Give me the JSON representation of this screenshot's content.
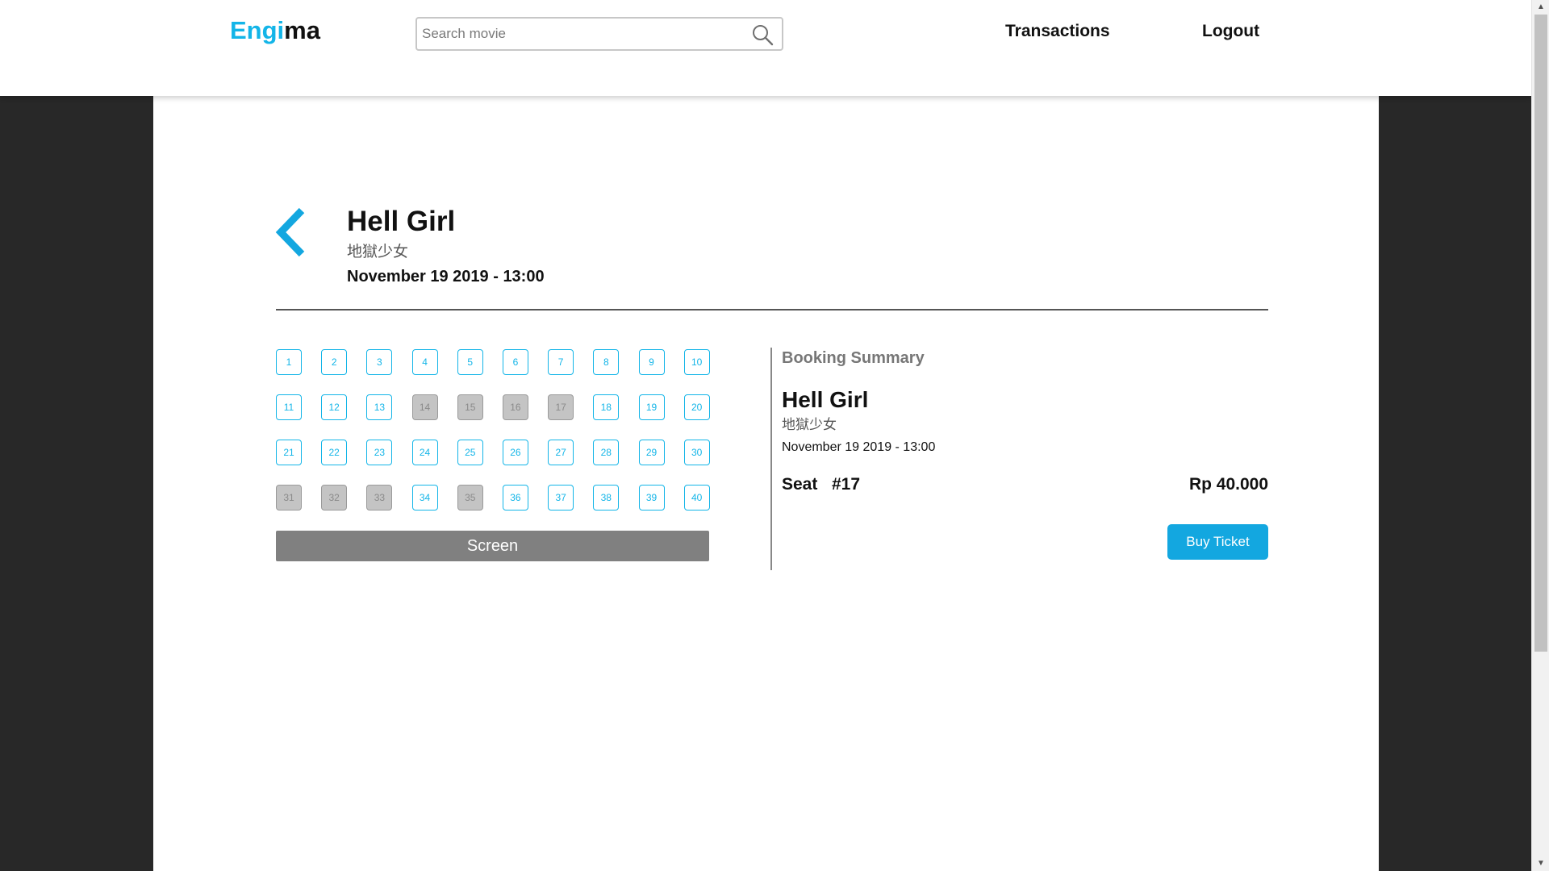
{
  "brand": {
    "part1": "Engi",
    "part2": "ma"
  },
  "search": {
    "placeholder": "Search movie",
    "value": ""
  },
  "nav": {
    "transactions": "Transactions",
    "logout": "Logout"
  },
  "movie": {
    "title": "Hell Girl",
    "subtitle": "地獄少女",
    "datetime": "November 19 2019 - 13:00"
  },
  "seats": [
    {
      "n": "1",
      "taken": false
    },
    {
      "n": "2",
      "taken": false
    },
    {
      "n": "3",
      "taken": false
    },
    {
      "n": "4",
      "taken": false
    },
    {
      "n": "5",
      "taken": false
    },
    {
      "n": "6",
      "taken": false
    },
    {
      "n": "7",
      "taken": false
    },
    {
      "n": "8",
      "taken": false
    },
    {
      "n": "9",
      "taken": false
    },
    {
      "n": "10",
      "taken": false
    },
    {
      "n": "11",
      "taken": false
    },
    {
      "n": "12",
      "taken": false
    },
    {
      "n": "13",
      "taken": false
    },
    {
      "n": "14",
      "taken": true
    },
    {
      "n": "15",
      "taken": true
    },
    {
      "n": "16",
      "taken": true
    },
    {
      "n": "17",
      "taken": true
    },
    {
      "n": "18",
      "taken": false
    },
    {
      "n": "19",
      "taken": false
    },
    {
      "n": "20",
      "taken": false
    },
    {
      "n": "21",
      "taken": false
    },
    {
      "n": "22",
      "taken": false
    },
    {
      "n": "23",
      "taken": false
    },
    {
      "n": "24",
      "taken": false
    },
    {
      "n": "25",
      "taken": false
    },
    {
      "n": "26",
      "taken": false
    },
    {
      "n": "27",
      "taken": false
    },
    {
      "n": "28",
      "taken": false
    },
    {
      "n": "29",
      "taken": false
    },
    {
      "n": "30",
      "taken": false
    },
    {
      "n": "31",
      "taken": true
    },
    {
      "n": "32",
      "taken": true
    },
    {
      "n": "33",
      "taken": true
    },
    {
      "n": "34",
      "taken": false
    },
    {
      "n": "35",
      "taken": true
    },
    {
      "n": "36",
      "taken": false
    },
    {
      "n": "37",
      "taken": false
    },
    {
      "n": "38",
      "taken": false
    },
    {
      "n": "39",
      "taken": false
    },
    {
      "n": "40",
      "taken": false
    }
  ],
  "screen_label": "Screen",
  "summary": {
    "heading": "Booking Summary",
    "title": "Hell Girl",
    "subtitle": "地獄少女",
    "datetime": "November 19 2019 - 13:00",
    "seat_label": "Seat",
    "seat_number": "#17",
    "price": "Rp 40.000",
    "buy_label": "Buy Ticket"
  },
  "colors": {
    "accent": "#13b5e8",
    "button": "#13a7e0",
    "taken_seat": "#c4c4c4",
    "screen": "#808080",
    "backdrop": "#282828"
  },
  "icons": {
    "search": "search-icon",
    "back": "chevron-left-icon"
  }
}
